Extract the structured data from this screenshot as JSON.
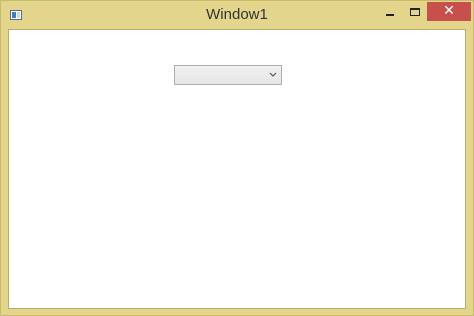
{
  "window": {
    "title": "Window1",
    "close_glyph": "✕",
    "accent_color": "#e3d58c",
    "close_color": "#c7504d"
  },
  "icons": {
    "app": "window-app-icon",
    "minimize": "minimize-icon",
    "maximize": "maximize-icon",
    "close": "close-icon",
    "dropdown": "chevron-down-icon"
  },
  "combobox": {
    "selected_value": ""
  }
}
